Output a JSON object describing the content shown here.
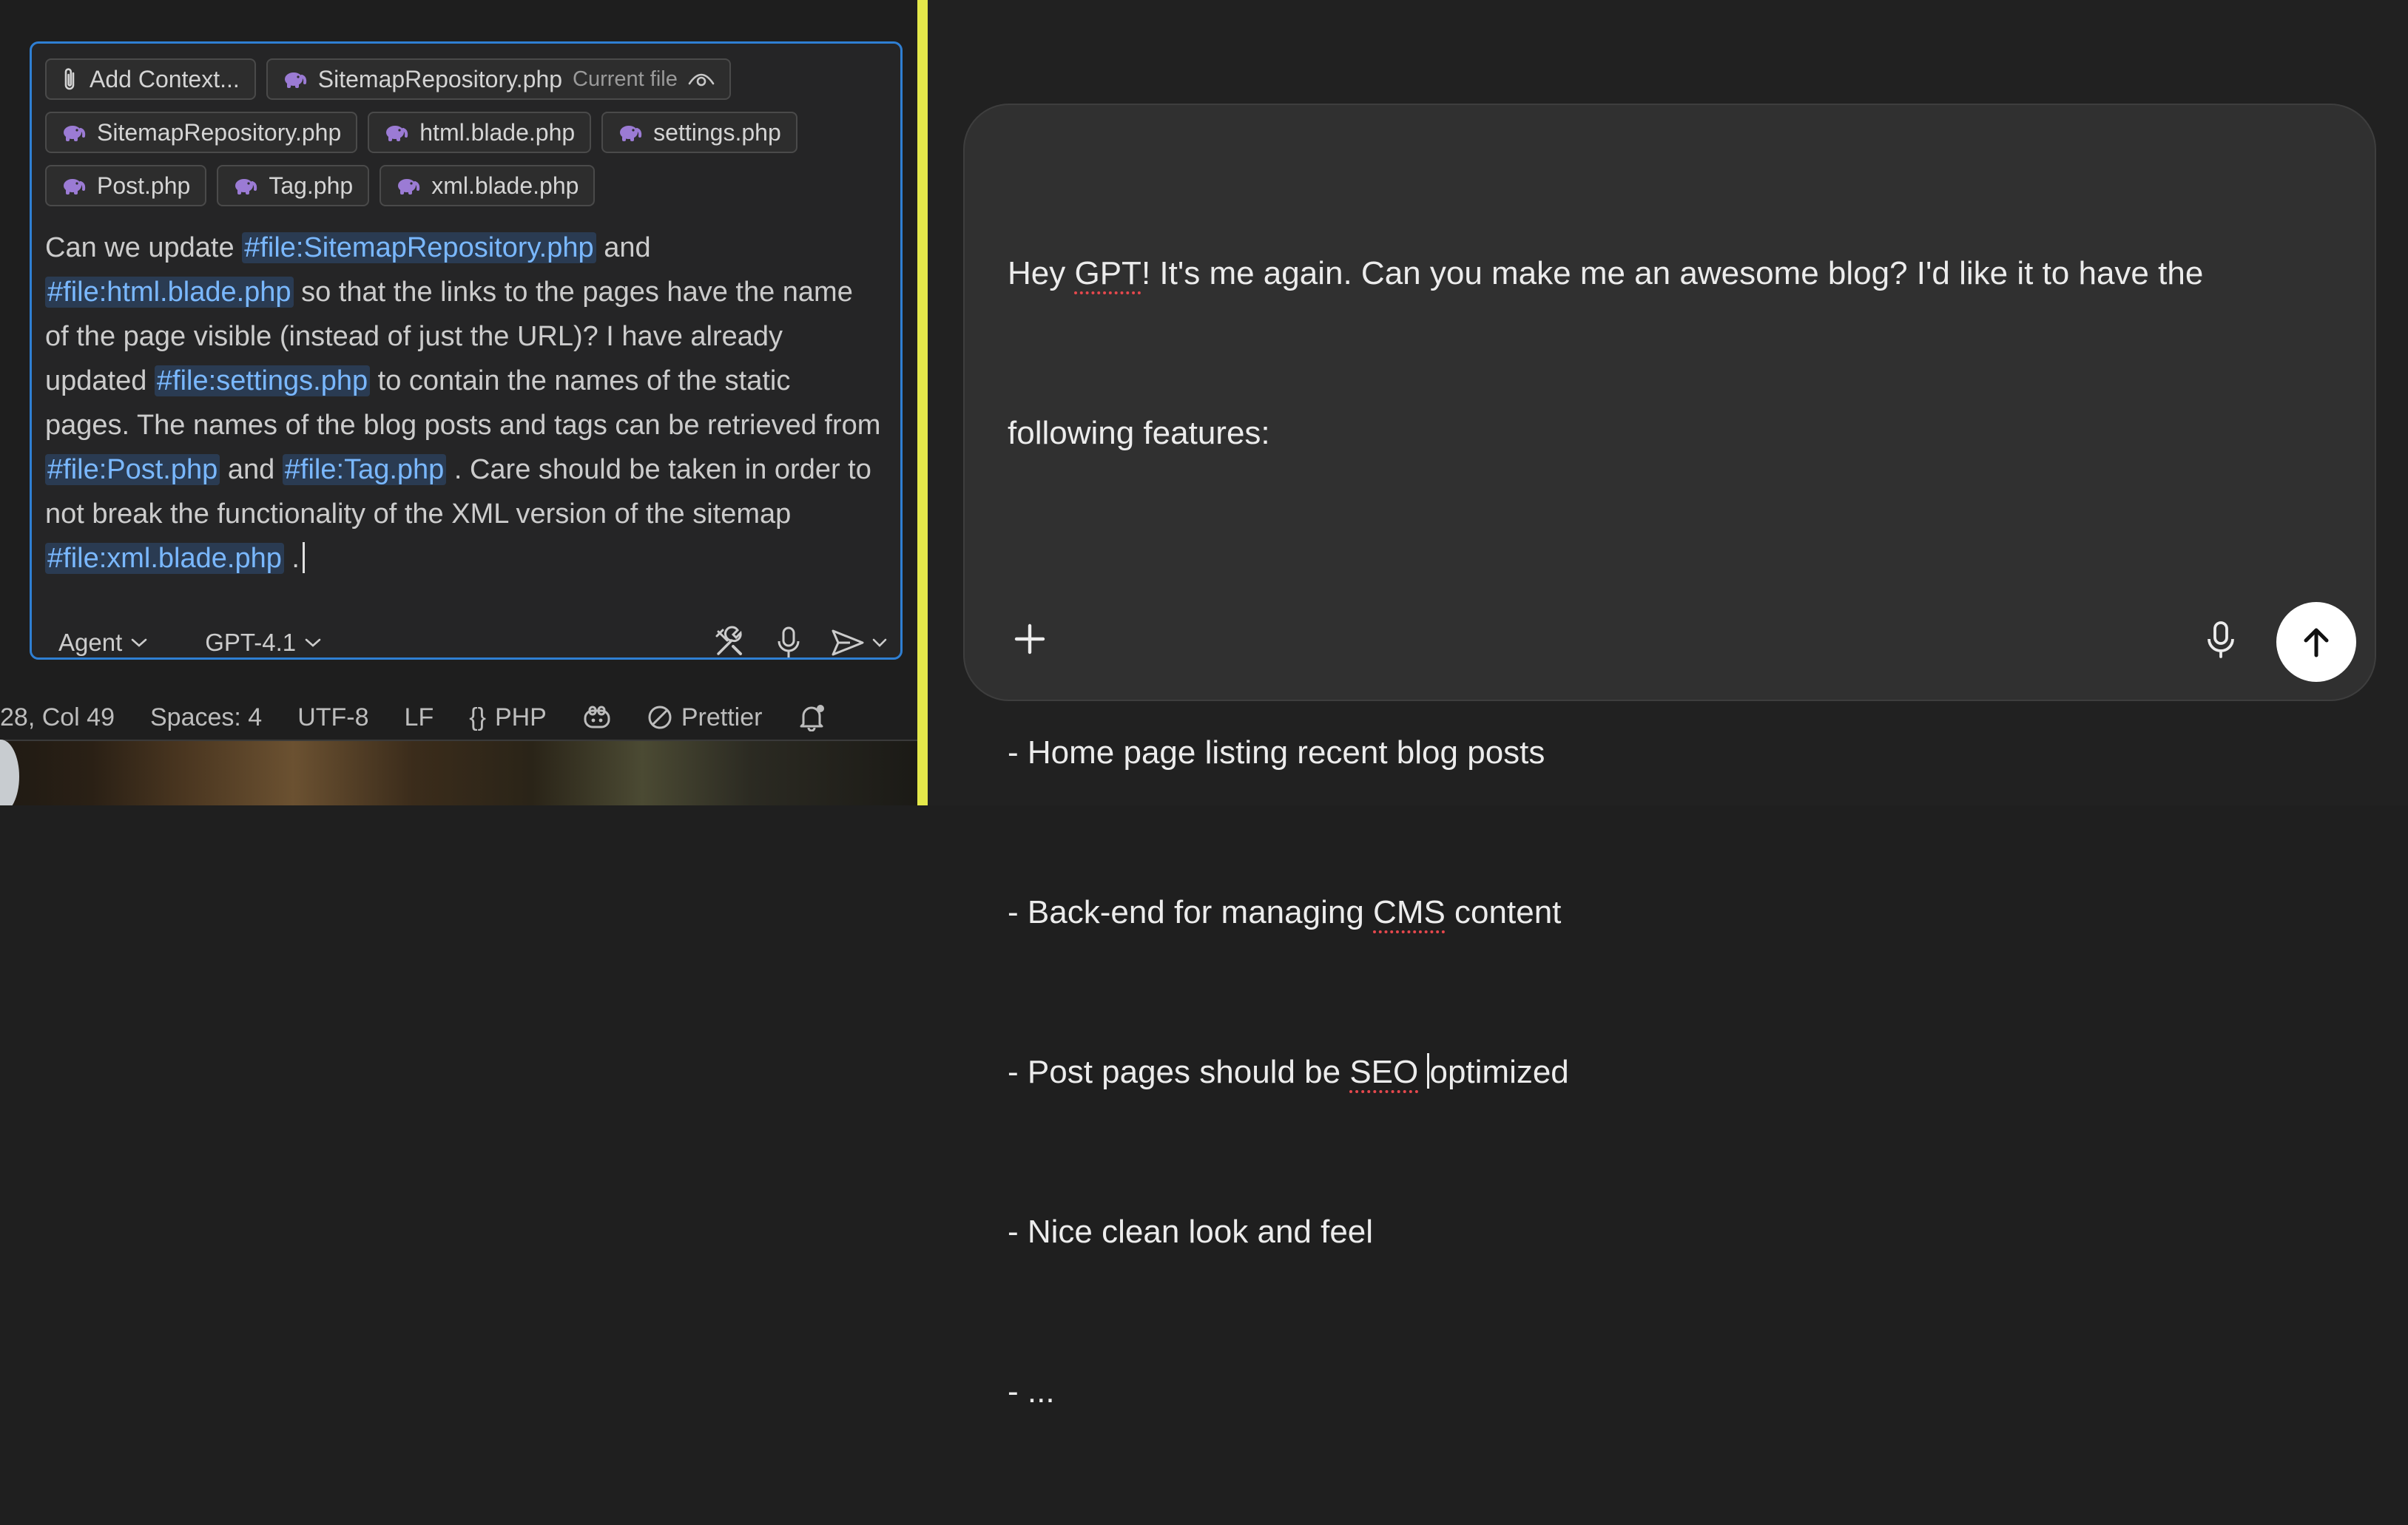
{
  "copilot": {
    "chips_row1": [
      {
        "label": "Add Context...",
        "icon": "paperclip-icon"
      },
      {
        "label": "SitemapRepository.php",
        "sub": "Current file",
        "icon": "php-elephant-icon",
        "trailing_icon": "eye-icon"
      }
    ],
    "chips_row2": [
      {
        "label": "SitemapRepository.php",
        "icon": "php-elephant-icon"
      },
      {
        "label": "html.blade.php",
        "icon": "php-elephant-icon"
      },
      {
        "label": "settings.php",
        "icon": "php-elephant-icon"
      }
    ],
    "chips_row3": [
      {
        "label": "Post.php",
        "icon": "php-elephant-icon"
      },
      {
        "label": "Tag.php",
        "icon": "php-elephant-icon"
      },
      {
        "label": "xml.blade.php",
        "icon": "php-elephant-icon"
      }
    ],
    "prompt": {
      "t1": "Can we update ",
      "r1": "#file:SitemapRepository.php",
      "t2": " and ",
      "r2": "#file:html.blade.php",
      "t3": " so that the links to the pages have the name of the page visible (instead of just the URL)? I have already updated ",
      "r3": "#file:settings.php",
      "t4": " to contain the names of the static pages. The names of the blog posts and tags can be retrieved from ",
      "r4": "#file:Post.php",
      "t5": " and ",
      "r5": "#file:Tag.php",
      "t6": " . Care should be taken in order to not break the functionality of the XML version of the sitemap ",
      "r6": "#file:xml.blade.php",
      "t7": " ."
    },
    "mode_label": "Agent",
    "model_label": "GPT-4.1"
  },
  "statusbar": {
    "position": "28, Col 49",
    "spaces": "Spaces: 4",
    "encoding": "UTF-8",
    "eol": "LF",
    "language_icon": "{}",
    "language": "PHP",
    "formatter": "Prettier"
  },
  "chatgpt": {
    "line1": {
      "a": "Hey ",
      "b": "GPT",
      "c": "! It's me again. Can you make me an awesome blog? I'd like it to have the"
    },
    "line2": "following features:",
    "line3": "- Home page listing recent blog posts",
    "line4": {
      "a": "- Back-end for managing ",
      "b": "CMS",
      "c": " content"
    },
    "line5": {
      "a": "- Post pages should be ",
      "b": "SEO",
      "c": " ",
      "d": "optimized"
    },
    "line6": "- Nice clean look and feel",
    "line7": "- ..."
  },
  "colors": {
    "panel_border": "#2f7fd3",
    "file_ref": "#7ab8ff",
    "divider": "#e4e84a",
    "composer_bg": "#303030",
    "spellcheck": "#e5484d"
  }
}
